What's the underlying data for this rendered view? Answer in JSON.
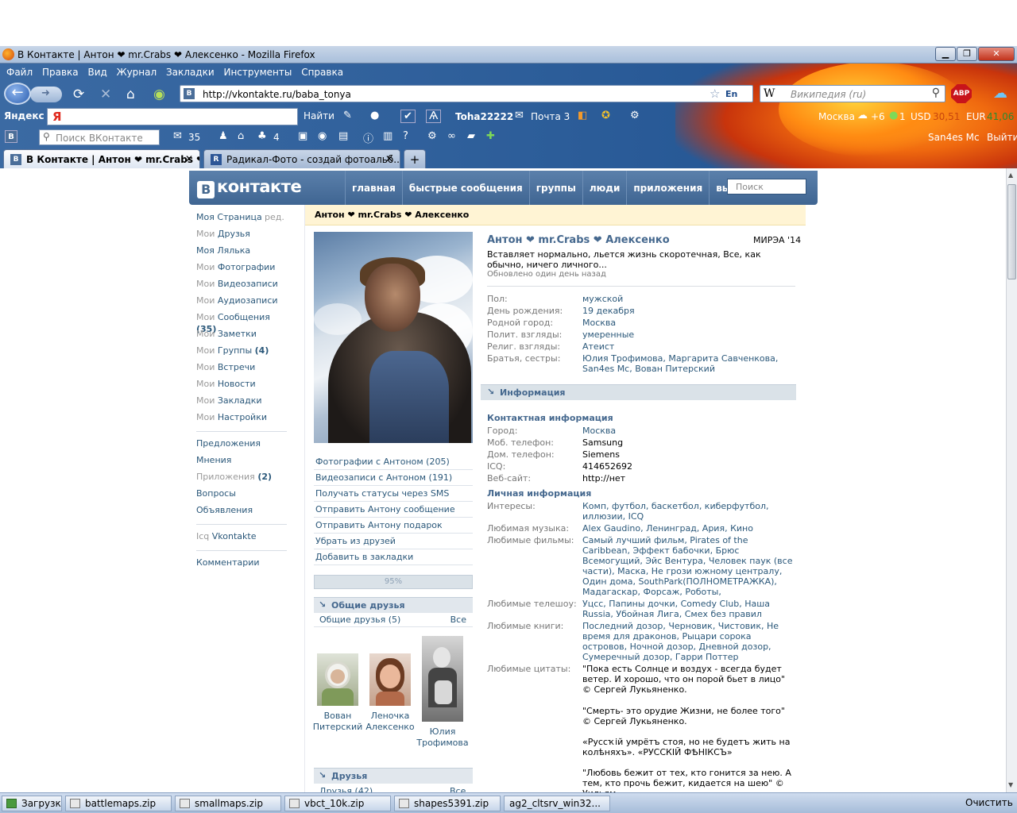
{
  "window": {
    "title": "В Контакте | Антон ❤ mr.Crabs ❤ Алексенко - Mozilla Firefox",
    "min": "▁",
    "max": "❐",
    "close": "✕"
  },
  "menu": [
    "Файл",
    "Правка",
    "Вид",
    "Журнал",
    "Закладки",
    "Инструменты",
    "Справка"
  ],
  "nav": {
    "url": "http://vkontakte.ru/baba_tonya",
    "lang": "En",
    "search_engine": "W",
    "search_placeholder": "Википедия (ru)",
    "abp": "ABP"
  },
  "yandex_bar": {
    "brand": "Яндекс",
    "logo": "Я",
    "find": "Найти",
    "user": "Toha22222",
    "mail": "Почта 3",
    "city": "Москва",
    "weather": "+6",
    "traffic": "1",
    "usd_label": "USD",
    "usd": "30,51",
    "eur_label": "EUR",
    "eur": "41,06"
  },
  "vk_bar": {
    "logo": "В",
    "search_placeholder": "Поиск ВКонтакте",
    "messages": "35",
    "groups": "4",
    "user": "San4es Mc",
    "logout": "Выйти"
  },
  "tabs": [
    {
      "label": "В Контакте | Антон ❤ mr.Crabs ❤...",
      "active": true
    },
    {
      "label": "Радикал-Фото - создай фотоальб...",
      "active": false
    }
  ],
  "vk": {
    "logo": "контакте",
    "nav": [
      "главная",
      "быстрые сообщения",
      "группы",
      "люди",
      "приложения",
      "выйти"
    ],
    "search": "Поиск"
  },
  "left_menu": {
    "my_page": "Моя Страница",
    "edit": "ред.",
    "my": "Мои",
    "friends": "Друзья",
    "doll": "Моя Лялька",
    "photos": "Фотографии",
    "videos": "Видеозаписи",
    "audio": "Аудиозаписи",
    "messages": "Сообщения",
    "messages_count": "(35)",
    "notes": "Заметки",
    "groups": "Группы",
    "groups_count": "(4)",
    "events": "Встречи",
    "news": "Новости",
    "bookmarks": "Закладки",
    "settings": "Настройки",
    "offers": "Предложения",
    "opinions": "Мнения",
    "apps": "Приложения",
    "apps_count": "(2)",
    "questions": "Вопросы",
    "ads": "Объявления",
    "icq": "Icq",
    "icq_link": "Vkontakte",
    "comments": "Комментарии"
  },
  "profile": {
    "crumb": "Антон ❤ mr.Crabs ❤ Алексенко",
    "name": "Антон ❤ mr.Crabs ❤ Алексенко",
    "university": "МИРЭА '14",
    "status": "Вставляет нормально, льется жизнь скоротечная, Все, как обычно, ничего личного...",
    "updated": "Обновлено один день назад",
    "links": [
      "Фотографии с Антоном (205)",
      "Видеозаписи с Антоном (191)",
      "Получать статусы через SMS",
      "Отправить Антону сообщение",
      "Отправить Антону подарок",
      "Убрать из друзей",
      "Добавить в закладки"
    ],
    "rating": "95%",
    "common_friends_title": "Общие друзья",
    "common_friends_count": "Общие друзья (5)",
    "all": "Все",
    "friends": [
      {
        "first": "Вован",
        "last": "Питерский"
      },
      {
        "first": "Леночка",
        "last": "Алексенко"
      },
      {
        "first": "Юлия",
        "last": "Трофимова"
      }
    ],
    "friends_title": "Друзья",
    "friends_count": "Друзья (42)",
    "basic": [
      {
        "k": "Пол:",
        "v": "мужской"
      },
      {
        "k": "День рождения:",
        "v": "19 декабря"
      },
      {
        "k": "Родной город:",
        "v": "Москва"
      },
      {
        "k": "Полит. взгляды:",
        "v": "умеренные"
      },
      {
        "k": "Религ. взгляды:",
        "v": "Атеист"
      },
      {
        "k": "Братья, сестры:",
        "v": "Юлия Трофимова, Маргарита Савченкова, San4es Mc, Вован Питерский"
      }
    ],
    "info_title": "Информация",
    "contact_title": "Контактная информация",
    "contact": [
      {
        "k": "Город:",
        "v": "Москва"
      },
      {
        "k": "Моб. телефон:",
        "v": "Samsung"
      },
      {
        "k": "Дом. телефон:",
        "v": "Siemens"
      },
      {
        "k": "ICQ:",
        "v": "414652692"
      },
      {
        "k": "Веб-сайт:",
        "v": "http://нет"
      }
    ],
    "personal_title": "Личная информация",
    "personal": [
      {
        "k": "Интересы:",
        "v": "Комп, футбол, баскетбол, киберфутбол, иллюзии, ICQ"
      },
      {
        "k": "Любимая музыка:",
        "v": "Alex Gaudino, Ленинград, Ария, Кино"
      },
      {
        "k": "Любимые фильмы:",
        "v": "Самый лучший фильм, Pirates of the Caribbean, Эффект бабочки, Брюс Всемогущий, Эйс Вентура, Человек паук (все части), Маска, Не грози южному централу, Один дома, SouthPark(ПОЛНОМЕТРАЖКА), Мадагаскар, Форсаж, Роботы,"
      },
      {
        "k": "Любимые телешоу:",
        "v": "Уцсс, Папины дочки, Comedy Club, Наша Russia, Убойная Лига, Смех без правил"
      },
      {
        "k": "Любимые книги:",
        "v": "Последний дозор, Черновик, Чистовик, Не время для драконов, Рыцари сорока островов, Ночной дозор, Дневной дозор, Сумеречный дозор, Гарри Поттер"
      },
      {
        "k": "Любимые цитаты:",
        "v": "\"Пока есть Солнце и воздух - всегда будет ветер. И хорошо, что он порой бьет в лицо\" © Сергей Лукьяненко."
      }
    ],
    "quote2": "\"Смерть- это орудие Жизни, не более того\" © Сергей Лукьяненко.",
    "quote3": "«Руссҡiй умрётъ стоя, но не будетъ жить на колѣняхъ». «РУССКIЙ ФѢНIКСЪ»",
    "quote4": "\"Любовь бежит от тех, кто гонится за нею. А тем, кто прочь бежит, кидается на шею\" © Уильям"
  },
  "taskbar": {
    "downloads": "Загрузки",
    "files": [
      "battlemaps.zip",
      "smallmaps.zip",
      "vbct_10k.zip",
      "shapes5391.zip",
      "ag2_cltsrv_win32..."
    ],
    "clear": "Очистить"
  }
}
